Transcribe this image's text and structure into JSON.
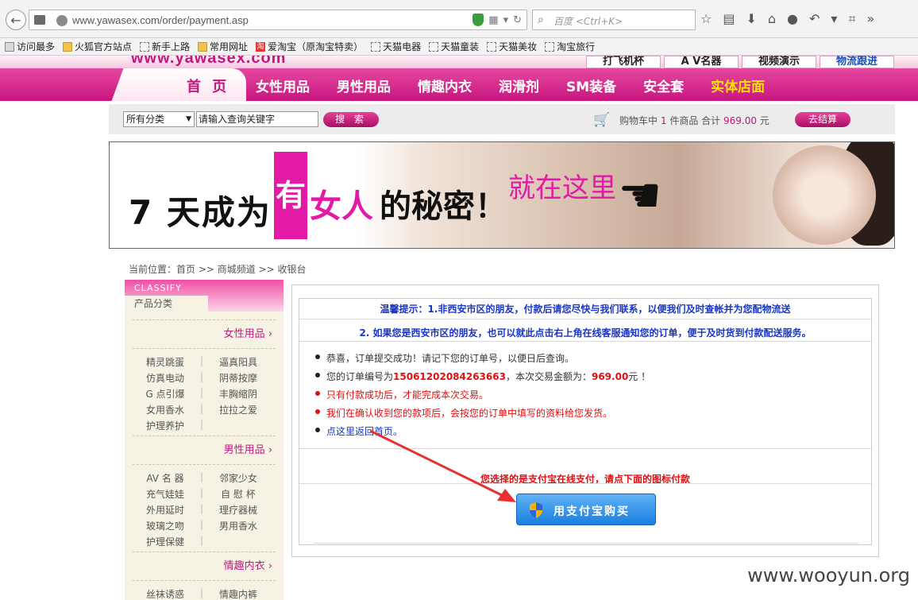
{
  "browser": {
    "url": "www.yawasex.com/order/payment.asp",
    "search_placeholder": "百度 <Ctrl+K>",
    "bookmarks": [
      "访问最多",
      "火狐官方站点",
      "新手上路",
      "常用网址",
      "爱淘宝（原淘宝特卖）",
      "天猫电器",
      "天猫童装",
      "天猫美妆",
      "淘宝旅行"
    ]
  },
  "site": {
    "logo_fragment": "www.yawasex.com",
    "top_links": [
      "打飞机杯",
      "A V名器",
      "视频演示",
      "物流跟进"
    ],
    "nav": {
      "home": "首 页",
      "items": [
        "女性用品",
        "男性用品",
        "情趣内衣",
        "润滑剂",
        "SM装备",
        "安全套",
        "实体店面"
      ]
    },
    "search": {
      "category": "所有分类",
      "keyword": "请输入查询关键字",
      "button": "搜 索"
    },
    "cart": {
      "prefix": "购物车中",
      "count": "1",
      "mid": "件商品 合计",
      "total": "969.00",
      "unit": "元",
      "checkout": "去结算"
    },
    "banner": {
      "t1": "7 天成为",
      "pink_char": "有",
      "t2": "女人",
      "t3": "的秘密！",
      "t4": "就在这里"
    },
    "breadcrumb": "当前位置：首页 >> 商城频道 >> 收银台"
  },
  "sidebar": {
    "en_title": "CLASSIFY",
    "tab": "产品分类",
    "cat1": {
      "title": "女性用品",
      "rows": [
        [
          "精灵跳蛋",
          "逼真阳具"
        ],
        [
          "仿真电动",
          "阴蒂按摩"
        ],
        [
          "G 点引爆",
          "丰胸缩阴"
        ],
        [
          "女用香水",
          "拉拉之爱"
        ],
        [
          "护理养护",
          ""
        ]
      ]
    },
    "cat2": {
      "title": "男性用品",
      "rows": [
        [
          "AV 名 器",
          "邻家少女"
        ],
        [
          "充气娃娃",
          "自 慰 杯"
        ],
        [
          "外用延时",
          "理疗器械"
        ],
        [
          "玻璃之吻",
          "男用香水"
        ],
        [
          "护理保健",
          ""
        ]
      ]
    },
    "cat3": {
      "title": "情趣内衣",
      "rows": [
        [
          "丝袜诱惑",
          "情趣内裤"
        ]
      ]
    }
  },
  "payment": {
    "tip1": "温馨提示：1.非西安市区的朋友，付款后请您尽快与我们联系，以便我们及时查帐并为您配物流送",
    "tip2": "2. 如果您是西安市区的朋友，也可以就此点击右上角在线客服通知您的订单，便于及时货到付款配送服务。",
    "msg1": "恭喜，订单提交成功！请记下您的订单号，以便日后查询。",
    "msg2_prefix": "您的订单编号为",
    "order_no": "15061202084263663",
    "msg2_mid": "，本次交易金额为：",
    "amount": "969.00",
    "msg2_suffix": "元 ！",
    "msg3": "只有付款成功后，才能完成本次交易。",
    "msg4": "我们在确认收到您的款项后，会按您的订单中填写的资料给您发货。",
    "msg5": "点这里返回首页。",
    "pay_note": "您选择的是支付宝在线支付，请点下面的图标付款",
    "alipay_button": "用支付宝购买"
  },
  "watermark": "www.wooyun.org",
  "colors": {
    "brand_pink": "#c8157f",
    "alert_red": "#e01010",
    "info_blue": "#1836c8",
    "alipay_blue": "#1b7fe0"
  }
}
